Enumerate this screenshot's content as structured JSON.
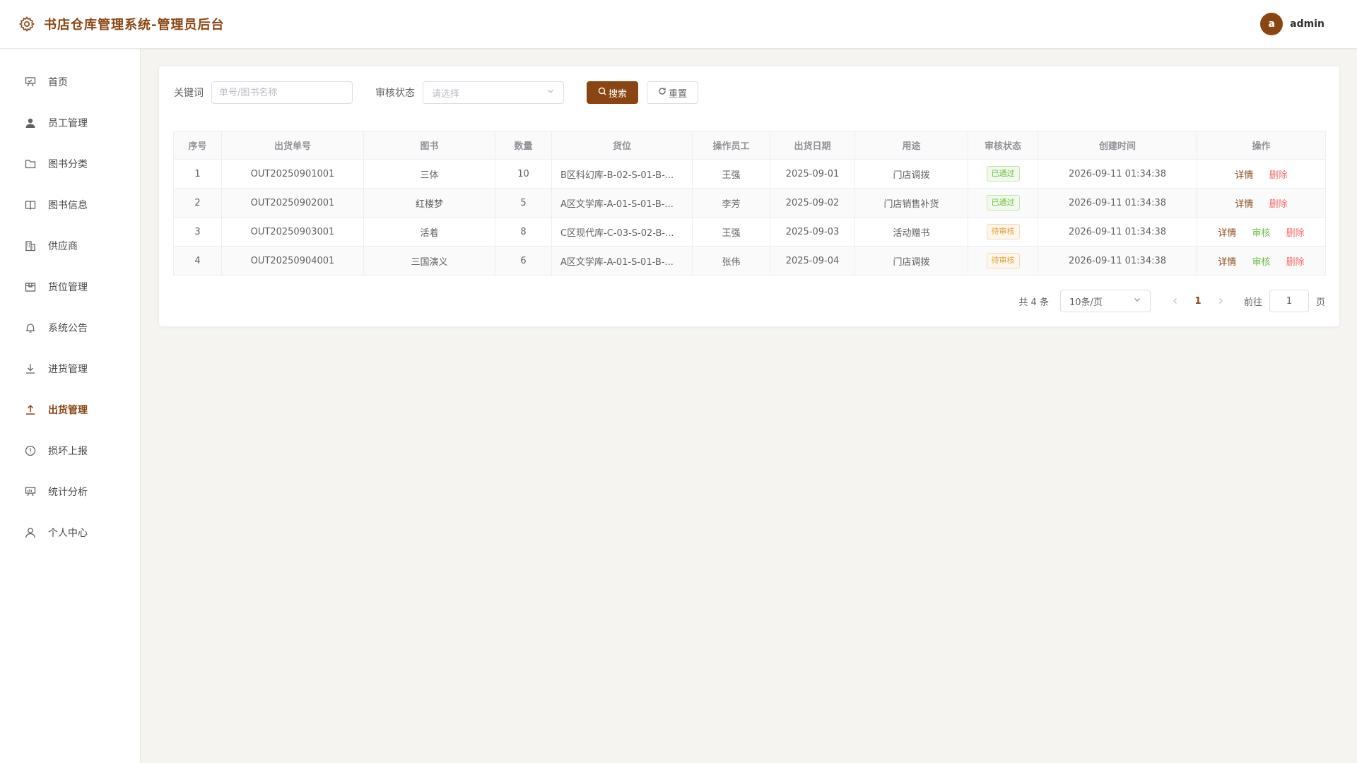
{
  "header": {
    "title": "书店仓库管理系统-管理员后台",
    "avatar_letter": "a",
    "username": "admin"
  },
  "sidebar": {
    "items": [
      {
        "label": "首页",
        "icon": "presentation-icon"
      },
      {
        "label": "员工管理",
        "icon": "user-filled-icon"
      },
      {
        "label": "图书分类",
        "icon": "folder-icon"
      },
      {
        "label": "图书信息",
        "icon": "book-open-icon"
      },
      {
        "label": "供应商",
        "icon": "office-building-icon"
      },
      {
        "label": "货位管理",
        "icon": "box-icon"
      },
      {
        "label": "系统公告",
        "icon": "bell-icon"
      },
      {
        "label": "进货管理",
        "icon": "download-icon"
      },
      {
        "label": "出货管理",
        "icon": "upload-icon",
        "active": true
      },
      {
        "label": "损坏上报",
        "icon": "warning-circle-icon"
      },
      {
        "label": "统计分析",
        "icon": "chart-board-icon"
      },
      {
        "label": "个人中心",
        "icon": "user-outline-icon"
      }
    ]
  },
  "filters": {
    "keyword_label": "关键词",
    "keyword_value": "",
    "keyword_placeholder": "单号/图书名称",
    "status_label": "审核状态",
    "status_placeholder": "请选择",
    "search_label": "搜索",
    "reset_label": "重置"
  },
  "table": {
    "headers": [
      "序号",
      "出货单号",
      "图书",
      "数量",
      "货位",
      "操作员工",
      "出货日期",
      "用途",
      "审核状态",
      "创建时间",
      "操作"
    ],
    "rows": [
      {
        "index": "1",
        "order_no": "OUT20250901001",
        "book": "三体",
        "qty": "10",
        "location": "B区科幻库-B-02-S-01-B-...",
        "staff": "王强",
        "date": "2025-09-01",
        "purpose": "门店调拨",
        "status": "已通过",
        "status_type": "pass",
        "created": "2026-09-11 01:34:38",
        "ops": [
          "详情",
          "删除"
        ]
      },
      {
        "index": "2",
        "order_no": "OUT20250902001",
        "book": "红楼梦",
        "qty": "5",
        "location": "A区文学库-A-01-S-01-B-...",
        "staff": "李芳",
        "date": "2025-09-02",
        "purpose": "门店销售补货",
        "status": "已通过",
        "status_type": "pass",
        "created": "2026-09-11 01:34:38",
        "ops": [
          "详情",
          "删除"
        ]
      },
      {
        "index": "3",
        "order_no": "OUT20250903001",
        "book": "活着",
        "qty": "8",
        "location": "C区现代库-C-03-S-02-B-...",
        "staff": "王强",
        "date": "2025-09-03",
        "purpose": "活动赠书",
        "status": "待审核",
        "status_type": "pending",
        "created": "2026-09-11 01:34:38",
        "ops": [
          "详情",
          "审核",
          "删除"
        ]
      },
      {
        "index": "4",
        "order_no": "OUT20250904001",
        "book": "三国演义",
        "qty": "6",
        "location": "A区文学库-A-01-S-01-B-...",
        "staff": "张伟",
        "date": "2025-09-04",
        "purpose": "门店调拨",
        "status": "待审核",
        "status_type": "pending",
        "created": "2026-09-11 01:34:38",
        "ops": [
          "详情",
          "审核",
          "删除"
        ]
      }
    ]
  },
  "pagination": {
    "total_text": "共 4 条",
    "page_size": "10条/页",
    "current_page": "1",
    "goto_label": "前往",
    "goto_value": "1",
    "page_suffix": "页"
  },
  "colors": {
    "primary": "#8b4513",
    "success": "#67c23a",
    "warning": "#e6a23c",
    "danger": "#f56c6c"
  }
}
